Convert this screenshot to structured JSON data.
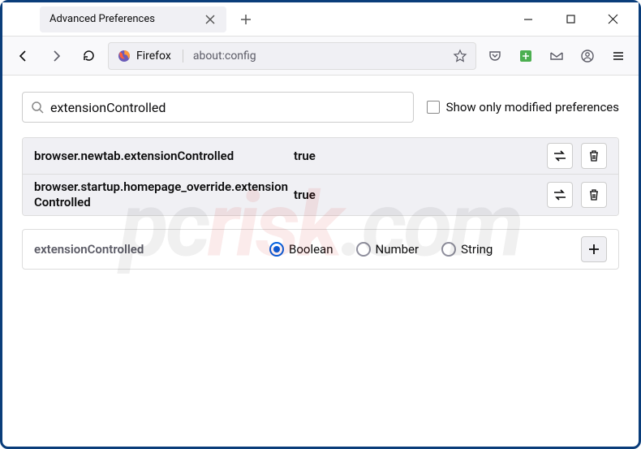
{
  "window": {
    "tab_title": "Advanced Preferences"
  },
  "toolbar": {
    "identity_label": "Firefox",
    "url": "about:config"
  },
  "search": {
    "value": "extensionControlled",
    "checkbox_label": "Show only modified preferences"
  },
  "prefs": [
    {
      "name": "browser.newtab.extensionControlled",
      "value": "true"
    },
    {
      "name": "browser.startup.homepage_override.extensionControlled",
      "value": "true"
    }
  ],
  "add_row": {
    "name": "extensionControlled",
    "type_selected": "Boolean",
    "options": [
      "Boolean",
      "Number",
      "String"
    ]
  },
  "watermark": {
    "a": "pc",
    "b": "risk",
    "c": ".com"
  }
}
